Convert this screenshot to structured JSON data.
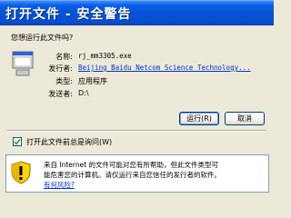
{
  "window": {
    "title": "打开文件 - 安全警告"
  },
  "dialog": {
    "question": "您想运行此文件吗?",
    "fields": [
      {
        "label": "名称:",
        "value": "rj_mm3305.exe"
      },
      {
        "label": "发行者:",
        "value": "Beijing Baidu Netcom Science Technology..."
      },
      {
        "label": "类型:",
        "value": "应用程序"
      },
      {
        "label": "发送者:",
        "value": "D:\\"
      }
    ],
    "run_label": "运行(R)",
    "cancel_label": "取消",
    "checkbox_label": "打开此文件前总是询问(W)",
    "checkbox_checked": true,
    "warning_line1": "来自 Internet 的文件可能对您有所帮助，但此文件类型可",
    "warning_line2": "能危害您的计算机。请仅运行来自您信任的发行者的软件。",
    "risk_link": "有何风险?"
  },
  "colors": {
    "titlebar": "#0553d6",
    "dialog_bg": "#ece9d8",
    "link": "#0033cc",
    "shield_yellow": "#ffd400"
  },
  "icons": {
    "app": "application-icon",
    "shield": "security-shield-icon",
    "checkmark": "checkmark-icon"
  }
}
